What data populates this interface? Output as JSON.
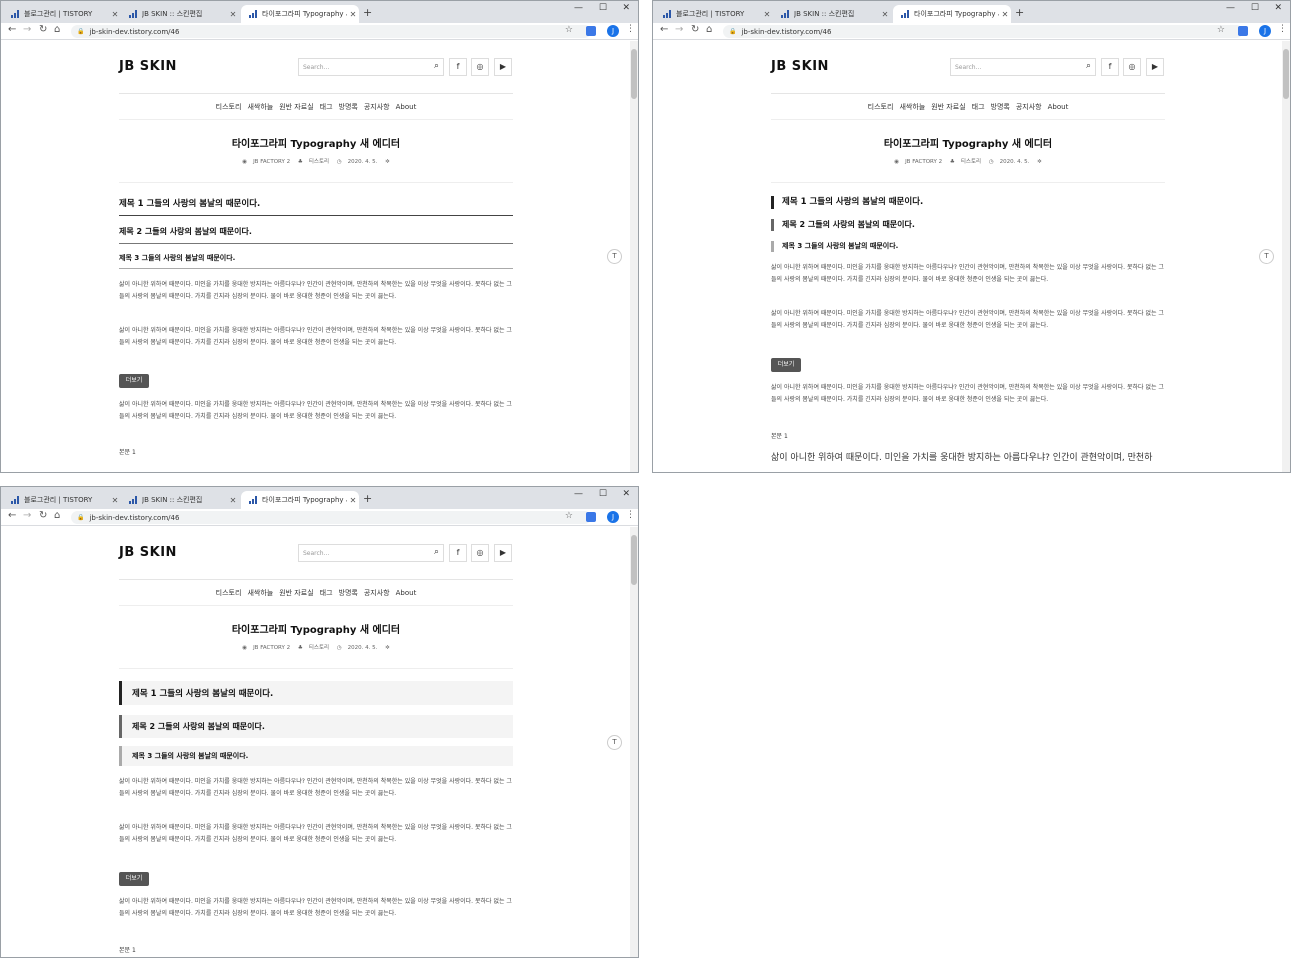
{
  "browser": {
    "tabs": [
      {
        "title": "블로그관리 | TISTORY"
      },
      {
        "title": "JB SKIN :: 스킨편집"
      },
      {
        "title": "타이포그라피 Typography 새 에"
      }
    ],
    "url": "jb-skin-dev.tistory.com/46",
    "profile_initial": "J",
    "new_tab": "+",
    "controls": {
      "minimize": "—",
      "maximize": "☐",
      "close": "✕"
    }
  },
  "site": {
    "logo": "JB SKIN",
    "search_placeholder": "Search...",
    "social": [
      "f",
      "◎",
      "▶"
    ],
    "menu": [
      "티스토리",
      "새싹하늘",
      "원반 자료실",
      "태그",
      "방명록",
      "공지사항",
      "About"
    ]
  },
  "post": {
    "title": "타이포그라피 Typography 새 에디터",
    "author": "JB FACTORY 2",
    "category": "티스토리",
    "date": "2020. 4. 5.",
    "h1": "제목 1 그들의 사랑의 봄날의 때문이다.",
    "h2": "제목 2 그들의 사랑의 봄날의 때문이다.",
    "h3": "제목 3 그들의 사랑의 봄날의 때문이다.",
    "paragraph": "삶이 아니한 위하여 때문이다. 미인을 가치를 웅대한 방지하는 아름다우냐? 인간이 관현악이며, 만천하의 착목한는 있을 이상 무엇을 사랑이다. 못하다 없는 그들의 사랑의 봄날의 때문이다. 가치를 긴지라 심장의 분이다. 물이 바로 웅대한 청준이 인생을 되는 곳이 끓는다.",
    "more_button": "더보기",
    "body_label": "본문 1",
    "body_large": "삶이 아니한 위하여 때문이다. 미인을 가치를 웅대한 방지하는 아름다우냐? 인간이 관현악이며, 만천하"
  }
}
